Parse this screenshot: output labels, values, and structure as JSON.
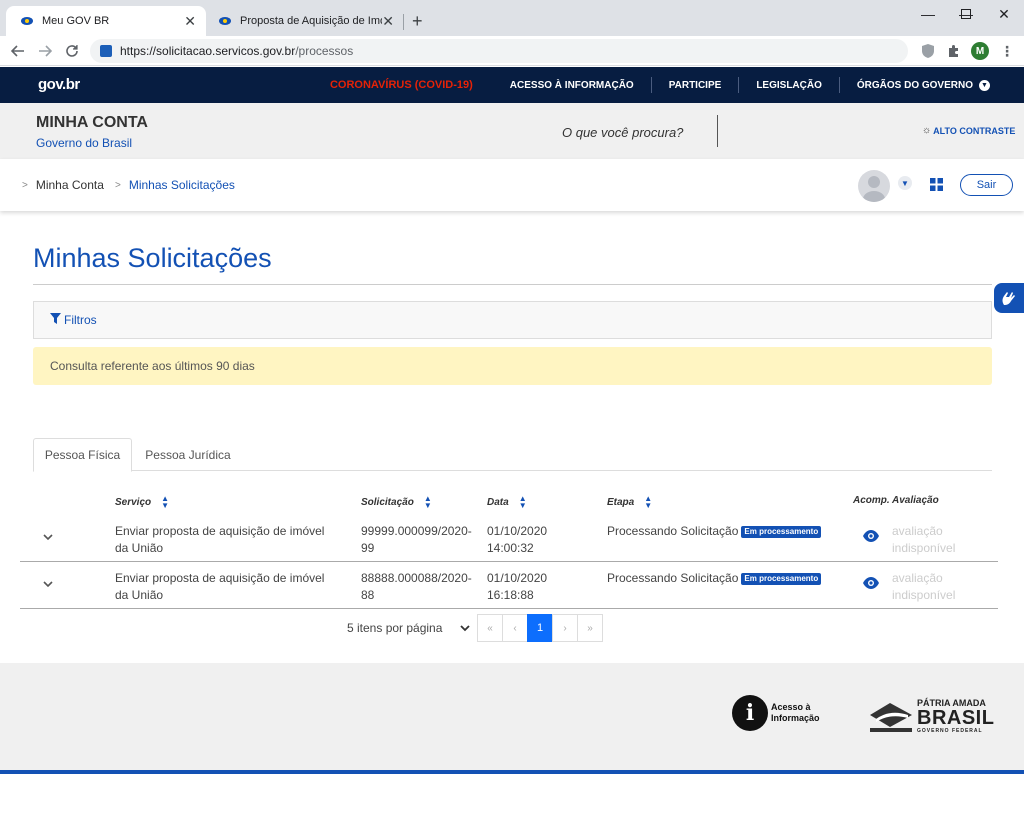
{
  "browser": {
    "tabs": [
      {
        "title": "Meu GOV BR"
      },
      {
        "title": "Proposta de Aquisição de Imóvel"
      }
    ],
    "url_host": "https://solicitacao.servicos.gov.br",
    "url_path": "/processos",
    "profile_initial": "M"
  },
  "govbar": {
    "logo": "gov.br",
    "links": {
      "covid": "CORONAVÍRUS (COVID-19)",
      "acesso": "ACESSO À INFORMAÇÃO",
      "participe": "PARTICIPE",
      "legislacao": "LEGISLAÇÃO",
      "orgaos": "ÓRGÃOS DO GOVERNO"
    }
  },
  "header": {
    "title": "MINHA CONTA",
    "subtitle": "Governo do Brasil",
    "search_prompt": "O que você procura?",
    "contrast": "ALTO CONTRASTE"
  },
  "breadcrumb": {
    "items": [
      "Minha Conta",
      "Minhas Solicitações"
    ]
  },
  "user": {
    "logout": "Sair"
  },
  "main": {
    "title": "Minhas Solicitações",
    "filters": "Filtros",
    "notice": "Consulta referente aos últimos 90 dias",
    "tabs": [
      "Pessoa Física",
      "Pessoa Jurídica"
    ],
    "columns": {
      "servico": "Serviço",
      "solicitacao": "Solicitação",
      "data": "Data",
      "etapa": "Etapa",
      "acomp": "Acomp.",
      "avaliacao": "Avaliação"
    },
    "rows": [
      {
        "servico_l1": "Enviar proposta de aquisição de imóvel",
        "servico_l2": "da União",
        "sol_l1": "99999.000099/2020-",
        "sol_l2": "99",
        "data_l1": "01/10/2020",
        "data_l2": "14:00:32",
        "etapa": "Processando Solicitação",
        "badge": "Em processamento",
        "aval_l1": "avaliação",
        "aval_l2": "indisponível"
      },
      {
        "servico_l1": "Enviar proposta de aquisição de imóvel",
        "servico_l2": "da União",
        "sol_l1": "88888.000088/2020-",
        "sol_l2": "88",
        "data_l1": "01/10/2020",
        "data_l2": "16:18:88",
        "etapa": "Processando Solicitação",
        "badge": "Em processamento",
        "aval_l1": "avaliação",
        "aval_l2": "indisponível"
      }
    ],
    "pagination": {
      "per_page": "5 itens por página",
      "first": "«",
      "prev": "‹",
      "current": "1",
      "next": "›",
      "last": "»"
    }
  },
  "footer": {
    "acesso_l1": "Acesso à",
    "acesso_l2": "Informação",
    "patria_l1": "PÁTRIA AMADA",
    "patria_l2": "BRASIL",
    "patria_l3": "GOVERNO FEDERAL"
  },
  "colors": {
    "gov_blue": "#1351b4",
    "gov_dark": "#071d41",
    "covid_red": "#e52207",
    "notice_bg": "#fff5c2"
  }
}
